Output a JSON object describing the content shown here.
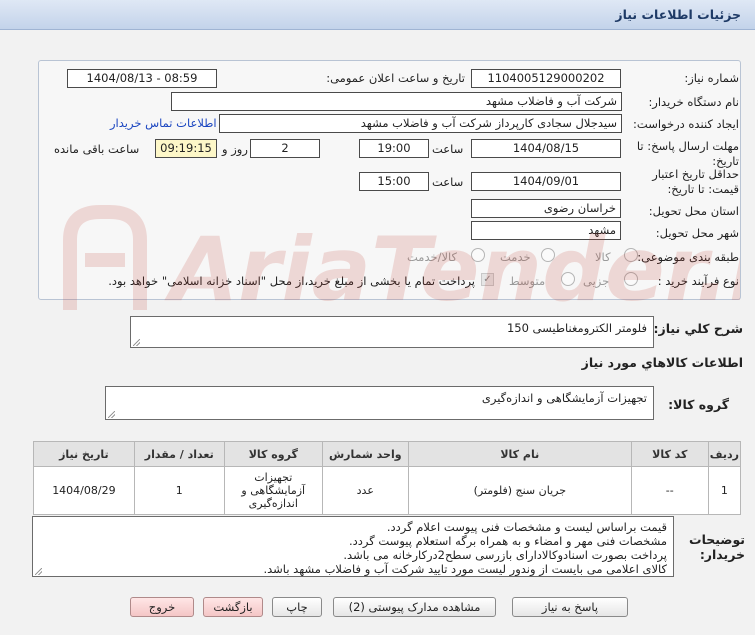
{
  "header": {
    "title": "جزئیات اطلاعات نیاز"
  },
  "form": {
    "need_number_label": "شماره نیاز:",
    "need_number": "1104005129000202",
    "announce_label": "تاریخ و ساعت اعلان عمومی:",
    "announce_value": "1404/08/13 - 08:59",
    "buyer_org_label": "نام دستگاه خریدار:",
    "buyer_org": "شرکت آب و فاضلاب مشهد",
    "creator_label": "ایجاد کننده درخواست:",
    "creator": "سیدجلال سجادی کارپرداز شرکت آب و فاضلاب مشهد",
    "contact_link": "اطلاعات تماس خریدار",
    "deadline_label": "مهلت ارسال پاسخ: تا تاریخ:",
    "deadline_date": "1404/08/15",
    "time_label": "ساعت",
    "deadline_time": "19:00",
    "days_value": "2",
    "days_label": "روز و",
    "remaining_time": "09:19:15",
    "remaining_label": "ساعت باقی مانده",
    "validity_label": "حداقل تاریخ اعتبار قیمت: تا تاریخ:",
    "validity_date": "1404/09/01",
    "validity_time": "15:00",
    "province_label": "استان محل تحویل:",
    "province": "خراسان رضوی",
    "city_label": "شهر محل تحویل:",
    "city": "مشهد",
    "category_label": "طبقه بندی موضوعی:",
    "category_options": [
      "کالا",
      "خدمت",
      "کالا/خدمت"
    ],
    "process_label": "نوع فرآیند خرید :",
    "process_options": [
      "جزیی",
      "متوسط"
    ],
    "payment_note": "پرداخت تمام یا بخشی از مبلغ خرید،از محل \"اسناد خزانه اسلامی\" خواهد بود."
  },
  "summary": {
    "label": "شرح کلي نیاز:",
    "text": "فلومتر الکترومغناطیسی 150"
  },
  "goods": {
    "section_title": "اطلاعات کالاهاي مورد نیاز",
    "group_label": "گروه کالا:",
    "group_text": "تجهیزات آزمایشگاهی و اندازه‌گیری",
    "columns": [
      "ردیف",
      "کد کالا",
      "نام کالا",
      "واحد شمارش",
      "گروه کالا",
      "تعداد / مقدار",
      "تاریخ نیاز"
    ],
    "rows": [
      [
        "1",
        "--",
        "جریان سنج (فلومتر)",
        "عدد",
        "تجهیزات آزمایشگاهی و اندازه‌گیری",
        "1",
        "1404/08/29"
      ]
    ]
  },
  "notes": {
    "label": "توضیحات خریدار:",
    "lines": [
      "قیمت براساس لیست و مشخصات فنی پیوست اعلام گردد.",
      "مشخصات فنی مهر و امضاء و به همراه برگه استعلام پیوست گردد.",
      "پرداخت بصورت اسنادوکالادارای بازرسی سطح2درکارخانه می باشد.",
      "کالای اعلامی می بایست از وندور لیست مورد تایید شرکت آب و فاضلاب مشهد باشد."
    ]
  },
  "buttons": {
    "reply": "پاسخ به نیاز",
    "attachments": "مشاهده مدارک پیوستی (2)",
    "print": "چاپ",
    "back": "بازگشت",
    "exit": "خروج"
  },
  "watermark": {
    "text": "AriaTender.net"
  },
  "colors": {
    "title_text": "#1e3a66",
    "link": "#1a45c0",
    "remaining_bg": "#fdf7c8",
    "danger_button": "#f4c6c6"
  }
}
